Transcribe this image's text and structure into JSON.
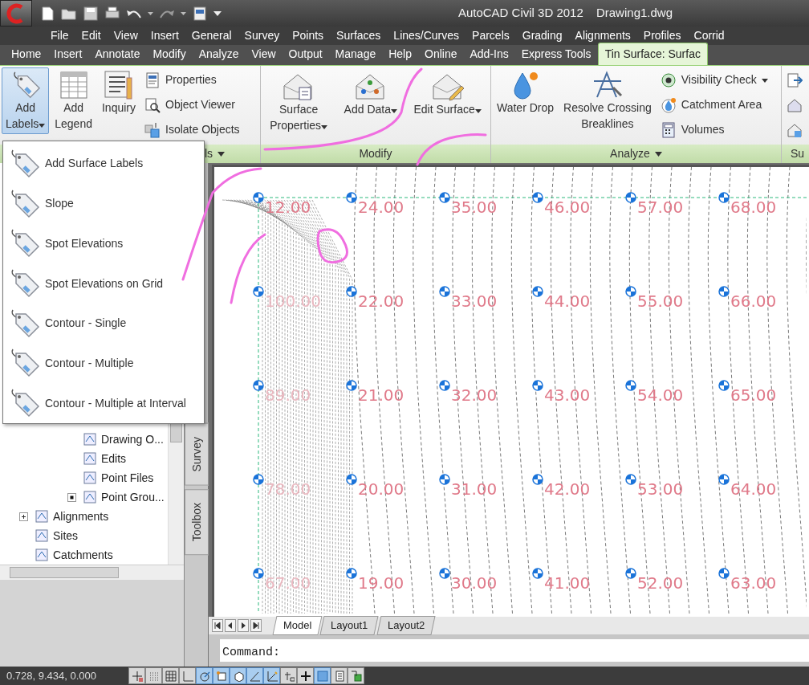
{
  "title_bar": {
    "app_title": "AutoCAD Civil 3D 2012",
    "document": "Drawing1.dwg"
  },
  "menu_bar": [
    "File",
    "Edit",
    "View",
    "Insert",
    "General",
    "Survey",
    "Points",
    "Surfaces",
    "Lines/Curves",
    "Parcels",
    "Grading",
    "Alignments",
    "Profiles",
    "Corrid"
  ],
  "ribbon_tabs": [
    {
      "label": "Home",
      "selected": false
    },
    {
      "label": "Insert",
      "selected": false
    },
    {
      "label": "Annotate",
      "selected": false
    },
    {
      "label": "Modify",
      "selected": false
    },
    {
      "label": "Analyze",
      "selected": false
    },
    {
      "label": "View",
      "selected": false
    },
    {
      "label": "Output",
      "selected": false
    },
    {
      "label": "Manage",
      "selected": false
    },
    {
      "label": "Help",
      "selected": false
    },
    {
      "label": "Online",
      "selected": false
    },
    {
      "label": "Add-Ins",
      "selected": false
    },
    {
      "label": "Express Tools",
      "selected": false
    },
    {
      "label": "Tin Surface: Surfac",
      "selected": true
    }
  ],
  "ribbon_panels": [
    {
      "title": "ls",
      "menu": true,
      "tools": [
        {
          "kind": "large",
          "lines": [
            "Add",
            "Labels"
          ],
          "pressed": true,
          "menu": true
        },
        {
          "kind": "large",
          "lines": [
            "Add",
            "Legend"
          ],
          "pressed": false,
          "menu": false
        },
        {
          "kind": "large",
          "lines": [
            "Inquiry"
          ],
          "pressed": false,
          "menu": false
        },
        {
          "kind": "stack",
          "items": [
            "Properties",
            "Object Viewer",
            "Isolate Objects"
          ]
        }
      ]
    },
    {
      "title": "Modify",
      "menu": false,
      "tools": [
        {
          "kind": "large",
          "lines": [
            "Surface",
            "Properties"
          ],
          "pressed": false,
          "menu": true
        },
        {
          "kind": "large",
          "lines": [
            "Add Data"
          ],
          "pressed": false,
          "menu": true
        },
        {
          "kind": "large",
          "lines": [
            "Edit Surface"
          ],
          "pressed": false,
          "menu": true
        }
      ]
    },
    {
      "title": "Analyze",
      "menu": true,
      "tools": [
        {
          "kind": "large",
          "lines": [
            "Water Drop"
          ],
          "pressed": false,
          "menu": false
        },
        {
          "kind": "large",
          "lines": [
            "Resolve Crossing",
            "Breaklines"
          ],
          "pressed": false,
          "menu": false
        },
        {
          "kind": "stack",
          "items": [
            "Visibility Check",
            "Catchment Area",
            "Volumes"
          ]
        }
      ]
    },
    {
      "title": "Su",
      "menu": false,
      "tools": [
        {
          "kind": "icon_stack"
        }
      ]
    }
  ],
  "dropdown_menu": {
    "items": [
      "Add Surface Labels",
      "Slope",
      "Spot Elevations",
      "Spot Elevations on Grid",
      "Contour - Single",
      "Contour - Multiple",
      "Contour - Multiple at Interval"
    ]
  },
  "tree": [
    {
      "children": [
        {
          "label": "Drawing O..."
        },
        {
          "label": "Edits"
        },
        {
          "label": "Point Files"
        },
        {
          "label": "Point Grou...",
          "kind": "dot"
        }
      ]
    },
    {
      "label": "Alignments",
      "kind": "plus"
    },
    {
      "label": "Sites"
    },
    {
      "label": "Catchments"
    }
  ],
  "palette_tabs": [
    "Survey",
    "Toolbox"
  ],
  "drawing": {
    "rows": [
      [
        {
          "text": "12.00",
          "faint": false
        },
        {
          "text": "24.00",
          "faint": false
        },
        {
          "text": "35.00",
          "faint": false
        },
        {
          "text": "46.00",
          "faint": false
        },
        {
          "text": "57.00",
          "faint": false
        },
        {
          "text": "68.00",
          "faint": false
        }
      ],
      [
        {
          "text": "100.00",
          "faint": true
        },
        {
          "text": "22.00",
          "faint": false
        },
        {
          "text": "33.00",
          "faint": false
        },
        {
          "text": "44.00",
          "faint": false
        },
        {
          "text": "55.00",
          "faint": false
        },
        {
          "text": "66.00",
          "faint": false
        }
      ],
      [
        {
          "text": "89.00",
          "faint": true
        },
        {
          "text": "21.00",
          "faint": false
        },
        {
          "text": "32.00",
          "faint": false
        },
        {
          "text": "43.00",
          "faint": false
        },
        {
          "text": "54.00",
          "faint": false
        },
        {
          "text": "65.00",
          "faint": false
        }
      ],
      [
        {
          "text": "78.00",
          "faint": true
        },
        {
          "text": "20.00",
          "faint": false
        },
        {
          "text": "31.00",
          "faint": false
        },
        {
          "text": "42.00",
          "faint": false
        },
        {
          "text": "53.00",
          "faint": false
        },
        {
          "text": "64.00",
          "faint": false
        }
      ],
      [
        {
          "text": "67.00",
          "faint": true
        },
        {
          "text": "19.00",
          "faint": false
        },
        {
          "text": "30.00",
          "faint": false
        },
        {
          "text": "41.00",
          "faint": false
        },
        {
          "text": "52.00",
          "faint": false
        },
        {
          "text": "63.00",
          "faint": false
        }
      ]
    ]
  },
  "layout_tabs": [
    {
      "label": "Model",
      "selected": true
    },
    {
      "label": "Layout1",
      "selected": false
    },
    {
      "label": "Layout2",
      "selected": false
    }
  ],
  "command_line": {
    "prompt": "Command:"
  },
  "status_bar": {
    "coordinates": "0.728,  9.434, 0.000",
    "toggles": [
      {
        "on": false
      },
      {
        "on": false
      },
      {
        "on": false
      },
      {
        "on": false
      },
      {
        "on": true
      },
      {
        "on": true
      },
      {
        "on": true
      },
      {
        "on": true
      },
      {
        "on": true
      },
      {
        "on": false
      },
      {
        "on": false
      },
      {
        "on": true
      },
      {
        "on": false
      },
      {
        "on": false
      }
    ]
  }
}
